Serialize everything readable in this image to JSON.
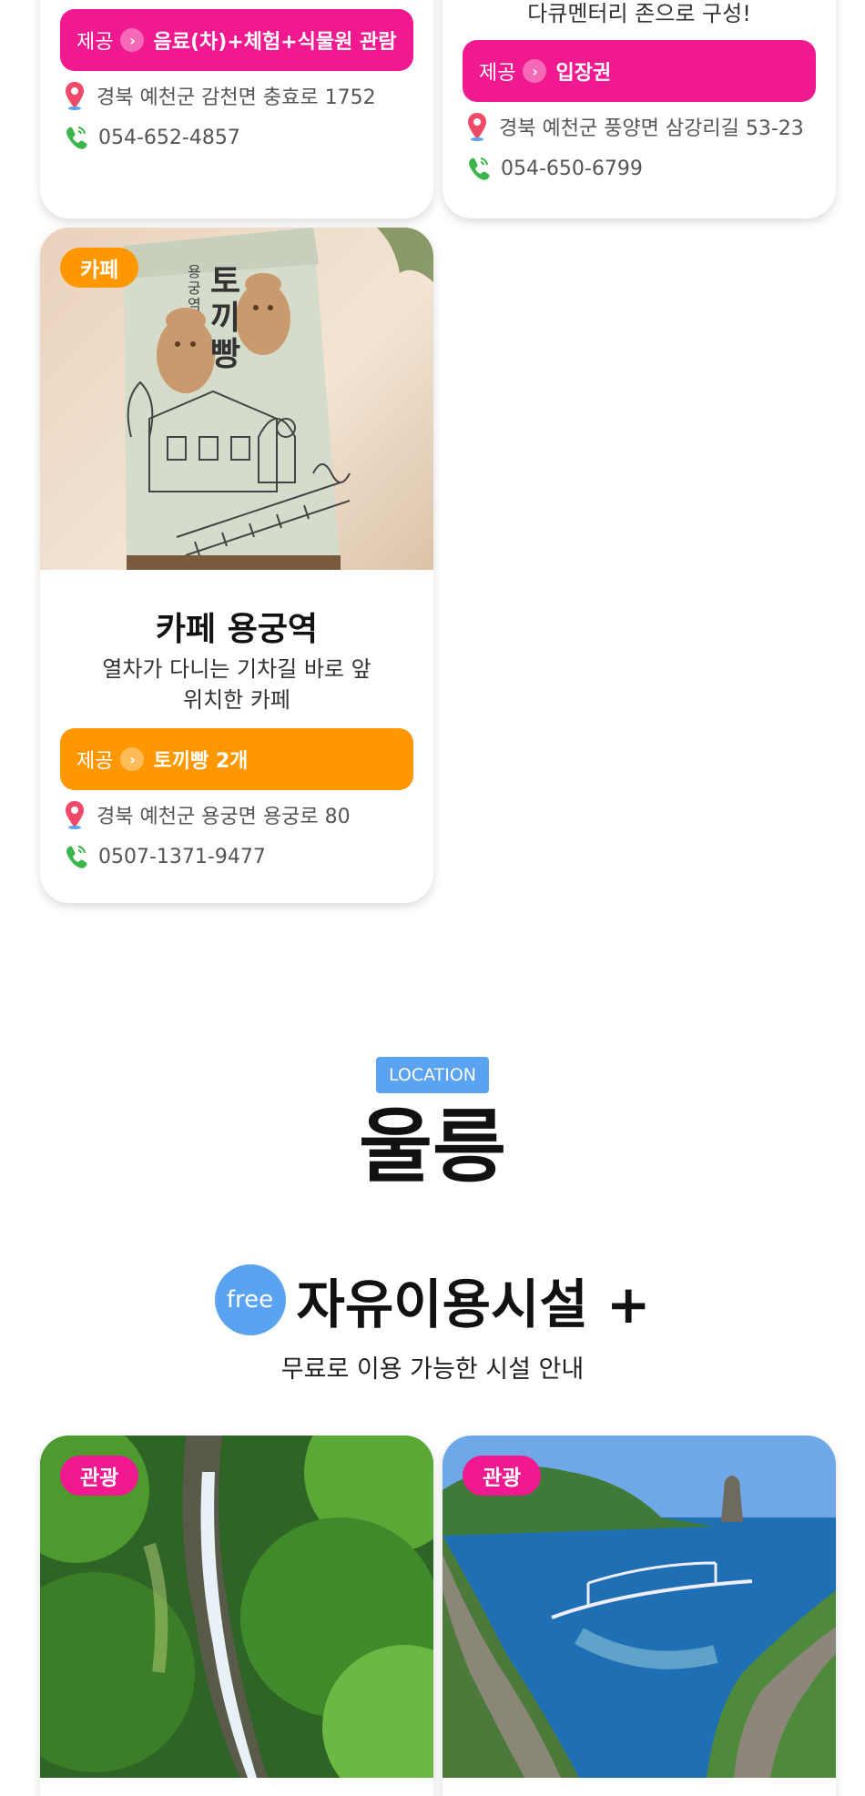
{
  "colors": {
    "pink": "#f0198f",
    "orange": "#ff9800",
    "blue": "#5aa3f0"
  },
  "cards_top": [
    {
      "provide_label": "제공",
      "provide_value": "음료(차)+체험+식물원 관람",
      "address": "경북 예천군 감천면 충효로 1752",
      "phone": "054-652-4857"
    },
    {
      "desc_tail": "다큐멘터리 존으로 구성!",
      "provide_label": "제공",
      "provide_value": "입장권",
      "address": "경북 예천군 풍양면 삼강리길 53-23",
      "phone": "054-650-6799"
    }
  ],
  "cafe_card": {
    "badge": "카페",
    "title": "카페 용궁역",
    "desc_line1": "열차가 다니는 기차길 바로 앞",
    "desc_line2": "위치한 카페",
    "provide_label": "제공",
    "provide_value": "토끼빵 2개",
    "address": "경북 예천군 용궁면 용궁로 80",
    "phone": "0507-1371-9477",
    "package_text": "토끼빵",
    "package_small": "용궁역"
  },
  "section": {
    "location_tag": "LOCATION",
    "region": "울릉",
    "free_badge": "free",
    "heading": "자유이용시설 +",
    "subheading": "무료로 이용 가능한 시설 안내"
  },
  "bottom_cards": [
    {
      "badge": "관광"
    },
    {
      "badge": "관광"
    }
  ]
}
